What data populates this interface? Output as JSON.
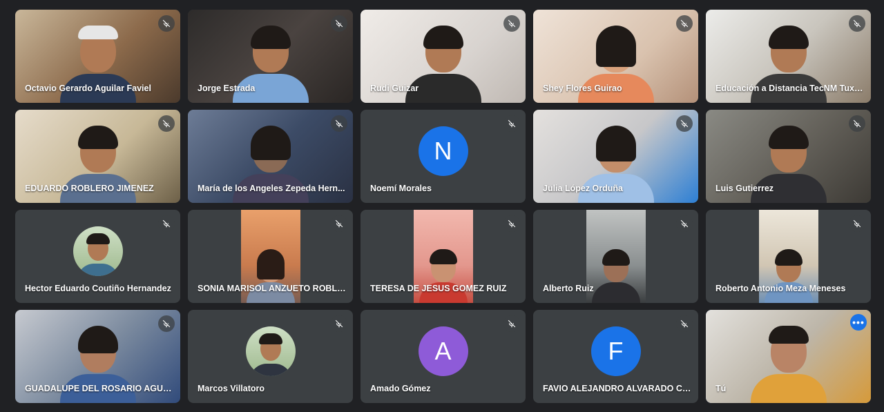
{
  "colors": {
    "background": "#202124",
    "tile": "#3c4043",
    "avatar_blue": "#1a73e8",
    "avatar_purple": "#8e5bd8",
    "self_outline": "#8ab4f8"
  },
  "participants": [
    {
      "name": "Octavio Gerardo Aguilar Faviel",
      "muted": true
    },
    {
      "name": "Jorge Estrada",
      "muted": true
    },
    {
      "name": "Rudi Guizar",
      "muted": true
    },
    {
      "name": "Shey Flores Guirao",
      "muted": true
    },
    {
      "name": "Educación a Distancia TecNM Tuxtl...",
      "muted": true
    },
    {
      "name": "EDUARDO ROBLERO JIMENEZ",
      "muted": true
    },
    {
      "name": "María de los Angeles Zepeda Hern...",
      "muted": true
    },
    {
      "name": "Noemí Morales",
      "muted": true,
      "avatar_letter": "N"
    },
    {
      "name": "Julia López Orduña",
      "muted": true
    },
    {
      "name": "Luis Gutierrez",
      "muted": true
    },
    {
      "name": "Hector Eduardo Coutiño Hernandez",
      "muted": true
    },
    {
      "name": "SONIA MARISOL ANZUETO ROBLE...",
      "muted": true
    },
    {
      "name": "TERESA DE JESUS GOMEZ RUIZ",
      "muted": true
    },
    {
      "name": "Alberto Ruiz",
      "muted": true
    },
    {
      "name": "Roberto Antonio Meza Meneses",
      "muted": true
    },
    {
      "name": "GUADALUPE DEL ROSARIO AGUIL...",
      "muted": true
    },
    {
      "name": "Marcos Villatoro",
      "muted": true
    },
    {
      "name": "Amado Gómez",
      "muted": true,
      "avatar_letter": "A"
    },
    {
      "name": "FAVIO ALEJANDRO ALVARADO CRUZ",
      "muted": true,
      "avatar_letter": "F"
    },
    {
      "name": "Tú",
      "muted": false,
      "more_options": "•••"
    }
  ],
  "icons": {
    "mic_off": "mic-off-icon",
    "more": "more-options-icon"
  }
}
